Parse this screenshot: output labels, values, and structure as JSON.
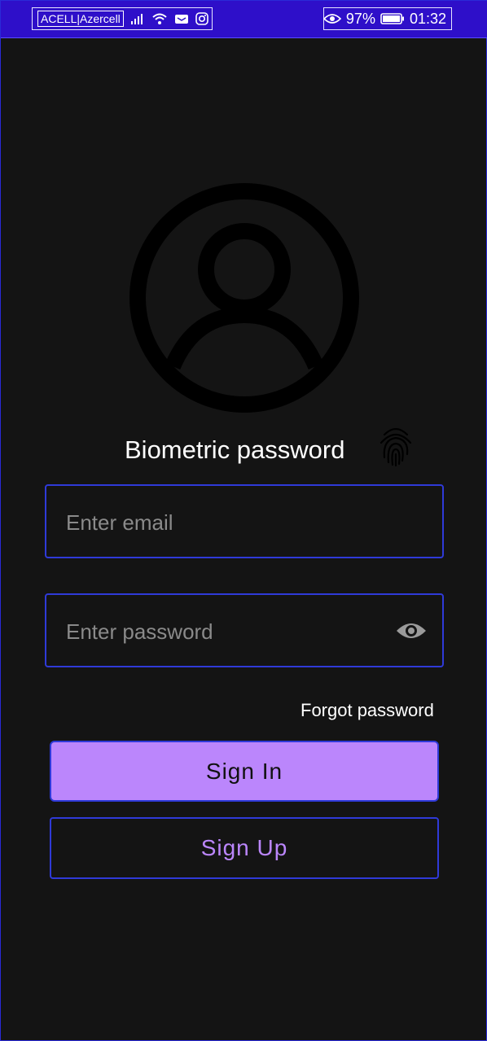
{
  "status_bar": {
    "carrier": "ACELL|Azercell",
    "battery_percent": "97%",
    "time": "01:32",
    "icons": [
      "signal-icon",
      "wifi-icon",
      "message-icon",
      "instagram-icon",
      "eye-icon",
      "battery-icon"
    ]
  },
  "profile": {
    "avatar_icon": "account-circle-icon"
  },
  "biometric": {
    "label": "Biometric password",
    "icon": "fingerprint-icon"
  },
  "form": {
    "email": {
      "placeholder": "Enter email",
      "value": ""
    },
    "password": {
      "placeholder": "Enter password",
      "value": "",
      "toggle_icon": "eye-icon"
    },
    "forgot_label": "Forgot password"
  },
  "actions": {
    "sign_in_label": "Sign In",
    "sign_up_label": "Sign Up"
  },
  "colors": {
    "background": "#141414",
    "accent": "#bb86fc",
    "status_bar": "#2e0fc9",
    "border": "#2f3ad8"
  }
}
